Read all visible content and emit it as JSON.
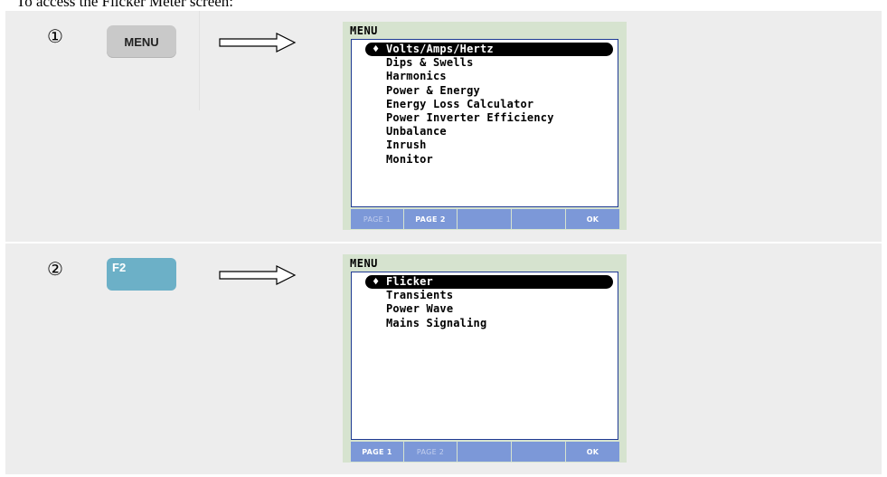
{
  "intro_text": "To access the Flicker Meter screen:",
  "steps": [
    {
      "number": "①",
      "key_label": "MENU",
      "screen": {
        "title": "MENU",
        "selected_icon": "up-down-arrow-icon",
        "items": [
          "Volts/Amps/Hertz",
          "Dips & Swells",
          "Harmonics",
          "Power & Energy",
          "Energy Loss Calculator",
          "Power Inverter Efficiency",
          "Unbalance",
          "Inrush",
          "Monitor"
        ],
        "softkeys": [
          "PAGE 1",
          "PAGE 2",
          "",
          "",
          "OK"
        ]
      }
    },
    {
      "number": "②",
      "key_label": "F2",
      "screen": {
        "title": "MENU",
        "selected_icon": "up-down-arrow-icon",
        "items": [
          "Flicker",
          "Transients",
          "Power Wave",
          "Mains Signaling"
        ],
        "softkeys": [
          "PAGE 1",
          "PAGE 2",
          "",
          "",
          "OK"
        ]
      }
    }
  ],
  "colors": {
    "panel_bg": "#ededed",
    "screen_bg": "#d6e3cf",
    "softkey_bg": "#7c98d8",
    "f2_key": "#6cb0c7",
    "menu_key": "#c9c9c9"
  }
}
